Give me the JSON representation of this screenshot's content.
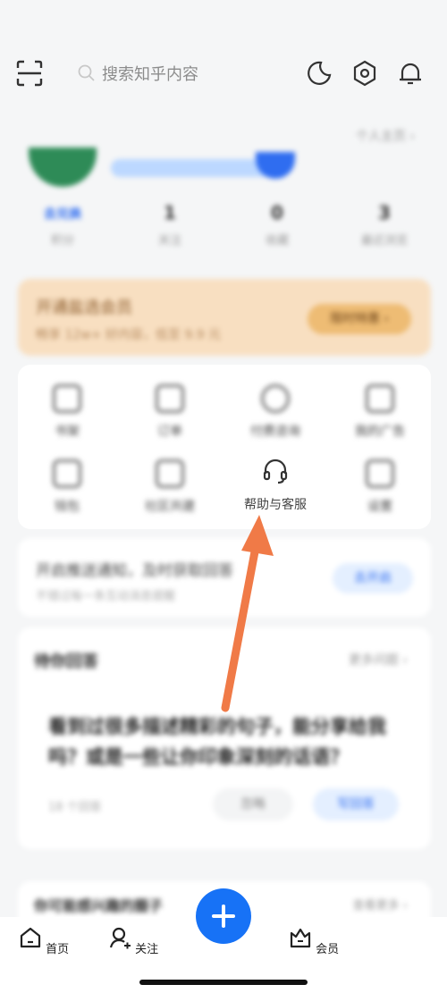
{
  "header": {
    "search_placeholder": "搜索知乎内容"
  },
  "profile": {
    "homepage_link": "个人主页 ›",
    "stats": [
      {
        "value": "去兑换",
        "label": "积分"
      },
      {
        "value": "1",
        "label": "关注"
      },
      {
        "value": "0",
        "label": "收藏"
      },
      {
        "value": "3",
        "label": "最近浏览"
      }
    ]
  },
  "vip_card": {
    "title": "开通盐选会员",
    "subtitle": "畅享 12w+ 好内容，低至 9.9 元",
    "button": "限时特惠 ›"
  },
  "tools": [
    {
      "label": "书架",
      "icon": "book-icon"
    },
    {
      "label": "订单",
      "icon": "order-icon"
    },
    {
      "label": "付费咨询",
      "icon": "coin-icon"
    },
    {
      "label": "我的广告",
      "icon": "chat-icon"
    },
    {
      "label": "钱包",
      "icon": "wallet-icon"
    },
    {
      "label": "社区共建",
      "icon": "shield-icon"
    },
    {
      "label": "帮助与客服",
      "icon": "headset-icon"
    },
    {
      "label": "设置",
      "icon": "settings-icon"
    }
  ],
  "notice": {
    "title": "开启推送通知，及时获取回答",
    "subtitle": "不错过每一条互动消息提醒",
    "button": "去开启"
  },
  "question_card": {
    "header": "待你回答",
    "more": "更多问题 ›",
    "body": "看到过很多描述精彩的句子，能分享给我吗？或是一些让你印象深刻的话语？",
    "meta": "18 个回答",
    "ignore": "忽略",
    "answer": "写回答"
  },
  "bottom_card": {
    "title": "你可能感兴趣的圈子",
    "more": "查看更多 ›"
  },
  "tabbar": {
    "home": "首页",
    "follow": "关注",
    "vip": "会员"
  },
  "colors": {
    "accent": "#1772f6",
    "arrow": "#f07a47"
  }
}
